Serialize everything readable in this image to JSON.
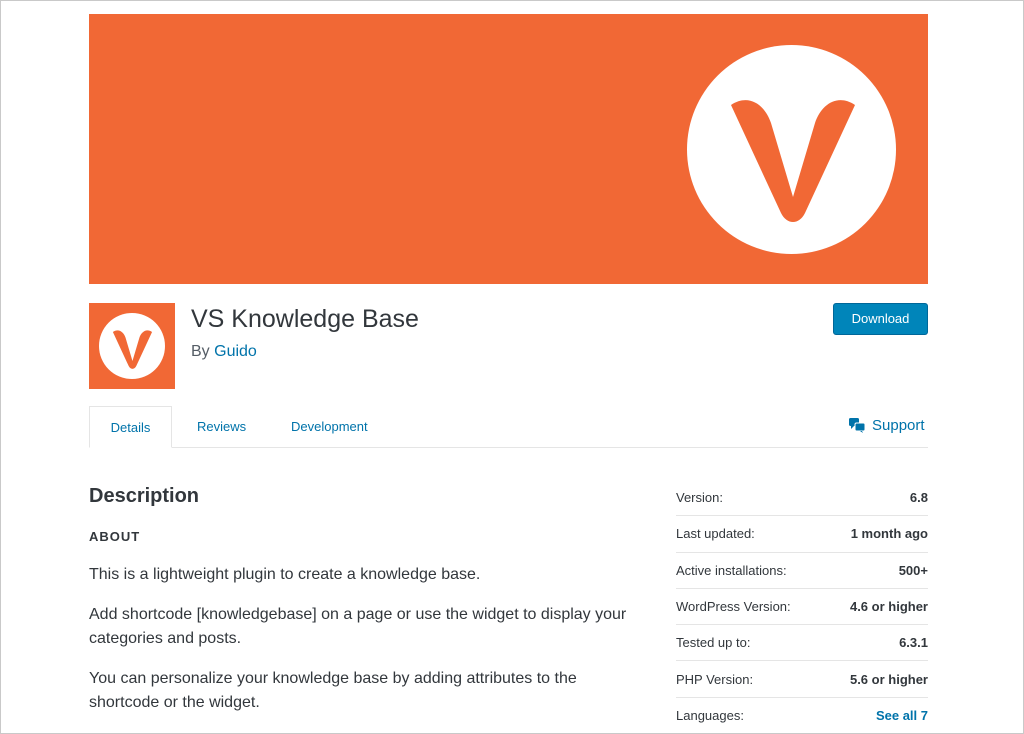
{
  "plugin": {
    "title": "VS Knowledge Base",
    "author_prefix": "By",
    "author_name": "Guido"
  },
  "actions": {
    "download_label": "Download"
  },
  "tabs": [
    {
      "label": "Details",
      "active": true
    },
    {
      "label": "Reviews",
      "active": false
    },
    {
      "label": "Development",
      "active": false
    }
  ],
  "support": {
    "label": "Support"
  },
  "description": {
    "heading": "Description",
    "section_label": "ABOUT",
    "paragraphs": [
      "This is a lightweight plugin to create a knowledge base.",
      "Add shortcode [knowledgebase] on a page or use the widget to display your categories and posts.",
      "You can personalize your knowledge base by adding attributes to the shortcode or the widget."
    ]
  },
  "meta": [
    {
      "label": "Version:",
      "value": "6.8"
    },
    {
      "label": "Last updated:",
      "value": "1 month ago"
    },
    {
      "label": "Active installations:",
      "value": "500+"
    },
    {
      "label": "WordPress Version:",
      "value": "4.6 or higher"
    },
    {
      "label": "Tested up to:",
      "value": "6.3.1"
    },
    {
      "label": "PHP Version:",
      "value": "5.6 or higher"
    },
    {
      "label": "Languages:",
      "value": "See all 7"
    }
  ],
  "colors": {
    "brand_orange": "#f16835",
    "link_blue": "#0073aa",
    "button_blue": "#0085ba"
  },
  "icons": {
    "banner": "v-logo-icon",
    "plugin": "v-logo-icon",
    "support": "chat-bubbles-icon"
  }
}
